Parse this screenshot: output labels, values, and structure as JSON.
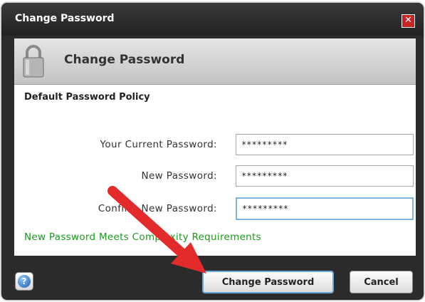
{
  "window": {
    "title": "Change Password"
  },
  "header": {
    "title": "Change Password",
    "icon": "lock-icon"
  },
  "policy": {
    "title": "Default Password Policy"
  },
  "form": {
    "current_label": "Your Current Password:",
    "current_value": "*********",
    "new_label": "New Password:",
    "new_value": "*********",
    "confirm_label": "Confirm New Password:",
    "confirm_value": "*********",
    "status_message": "New Password Meets Complexity Requirements"
  },
  "footer": {
    "help_icon": "?",
    "change_label": "Change Password",
    "cancel_label": "Cancel"
  },
  "colors": {
    "title_bar": "#2b2b2b",
    "close_button": "#cc2222",
    "status_text": "#1a9a1a",
    "focus_border": "#7db4dd",
    "annotation_arrow": "#e32b2b"
  }
}
